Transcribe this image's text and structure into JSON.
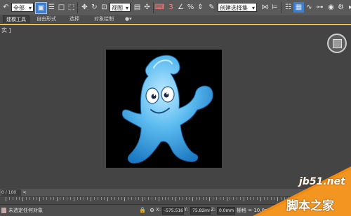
{
  "toolbar": {
    "selection_filter": "全部",
    "coord_system": "视图",
    "named_selection_set": "创建选择集"
  },
  "ribbon": {
    "tabs": [
      {
        "label": "建模工具"
      },
      {
        "label": "自由形式"
      },
      {
        "label": "选择"
      },
      {
        "label": "对象绘制"
      }
    ],
    "pin_label": "●▾"
  },
  "viewport": {
    "label": "[ + ] [ 透视 ] [ 真实 ]",
    "label_short": "实 ]"
  },
  "timeline": {
    "frame_field": "0 / 100",
    "left_arrow": "<",
    "right_arrow": ">"
  },
  "statusbar": {
    "message": "未选定任何对象",
    "x_label": "X:",
    "x_value": "-575.516mm",
    "y_label": "Y:",
    "y_value": "75.82mm",
    "z_label": "Z:",
    "z_value": "0.0mm",
    "grid_text": "栅格 = 10.0mm"
  },
  "watermark": {
    "site": "jb51.net",
    "brand": "脚本之家"
  },
  "colors": {
    "accent_viewport_border": "#e9c253",
    "watermark_orange": "#f08a10",
    "mascot_blue": "#4fb3ec"
  }
}
